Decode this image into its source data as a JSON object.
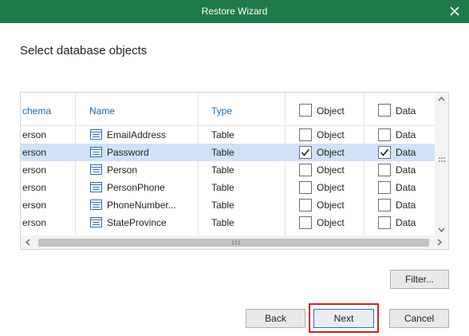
{
  "window": {
    "title": "Restore Wizard"
  },
  "heading": "Select database objects",
  "columns": {
    "schema": "chema",
    "name": "Name",
    "type": "Type",
    "object": "Object",
    "data": "Data"
  },
  "rows": [
    {
      "schema": "erson",
      "name": "EmailAddress",
      "type": "Table",
      "object_label": "Object",
      "object_checked": false,
      "data_label": "Data",
      "data_checked": false,
      "selected": false
    },
    {
      "schema": "erson",
      "name": "Password",
      "type": "Table",
      "object_label": "Object",
      "object_checked": true,
      "data_label": "Data",
      "data_checked": true,
      "selected": true
    },
    {
      "schema": "erson",
      "name": "Person",
      "type": "Table",
      "object_label": "Object",
      "object_checked": false,
      "data_label": "Data",
      "data_checked": false,
      "selected": false
    },
    {
      "schema": "erson",
      "name": "PersonPhone",
      "type": "Table",
      "object_label": "Object",
      "object_checked": false,
      "data_label": "Data",
      "data_checked": false,
      "selected": false
    },
    {
      "schema": "erson",
      "name": "PhoneNumber...",
      "type": "Table",
      "object_label": "Object",
      "object_checked": false,
      "data_label": "Data",
      "data_checked": false,
      "selected": false
    },
    {
      "schema": "erson",
      "name": "StateProvince",
      "type": "Table",
      "object_label": "Object",
      "object_checked": false,
      "data_label": "Data",
      "data_checked": false,
      "selected": false
    }
  ],
  "buttons": {
    "filter": "Filter...",
    "back": "Back",
    "next": "Next",
    "cancel": "Cancel"
  },
  "colors": {
    "titlebar": "#1f7a4a",
    "selected_row": "#cfe2f7",
    "header_text": "#1a6aa8",
    "highlight": "#d42020"
  },
  "icons": {
    "close": "close-icon",
    "table": "table-icon",
    "check": "check-icon"
  }
}
